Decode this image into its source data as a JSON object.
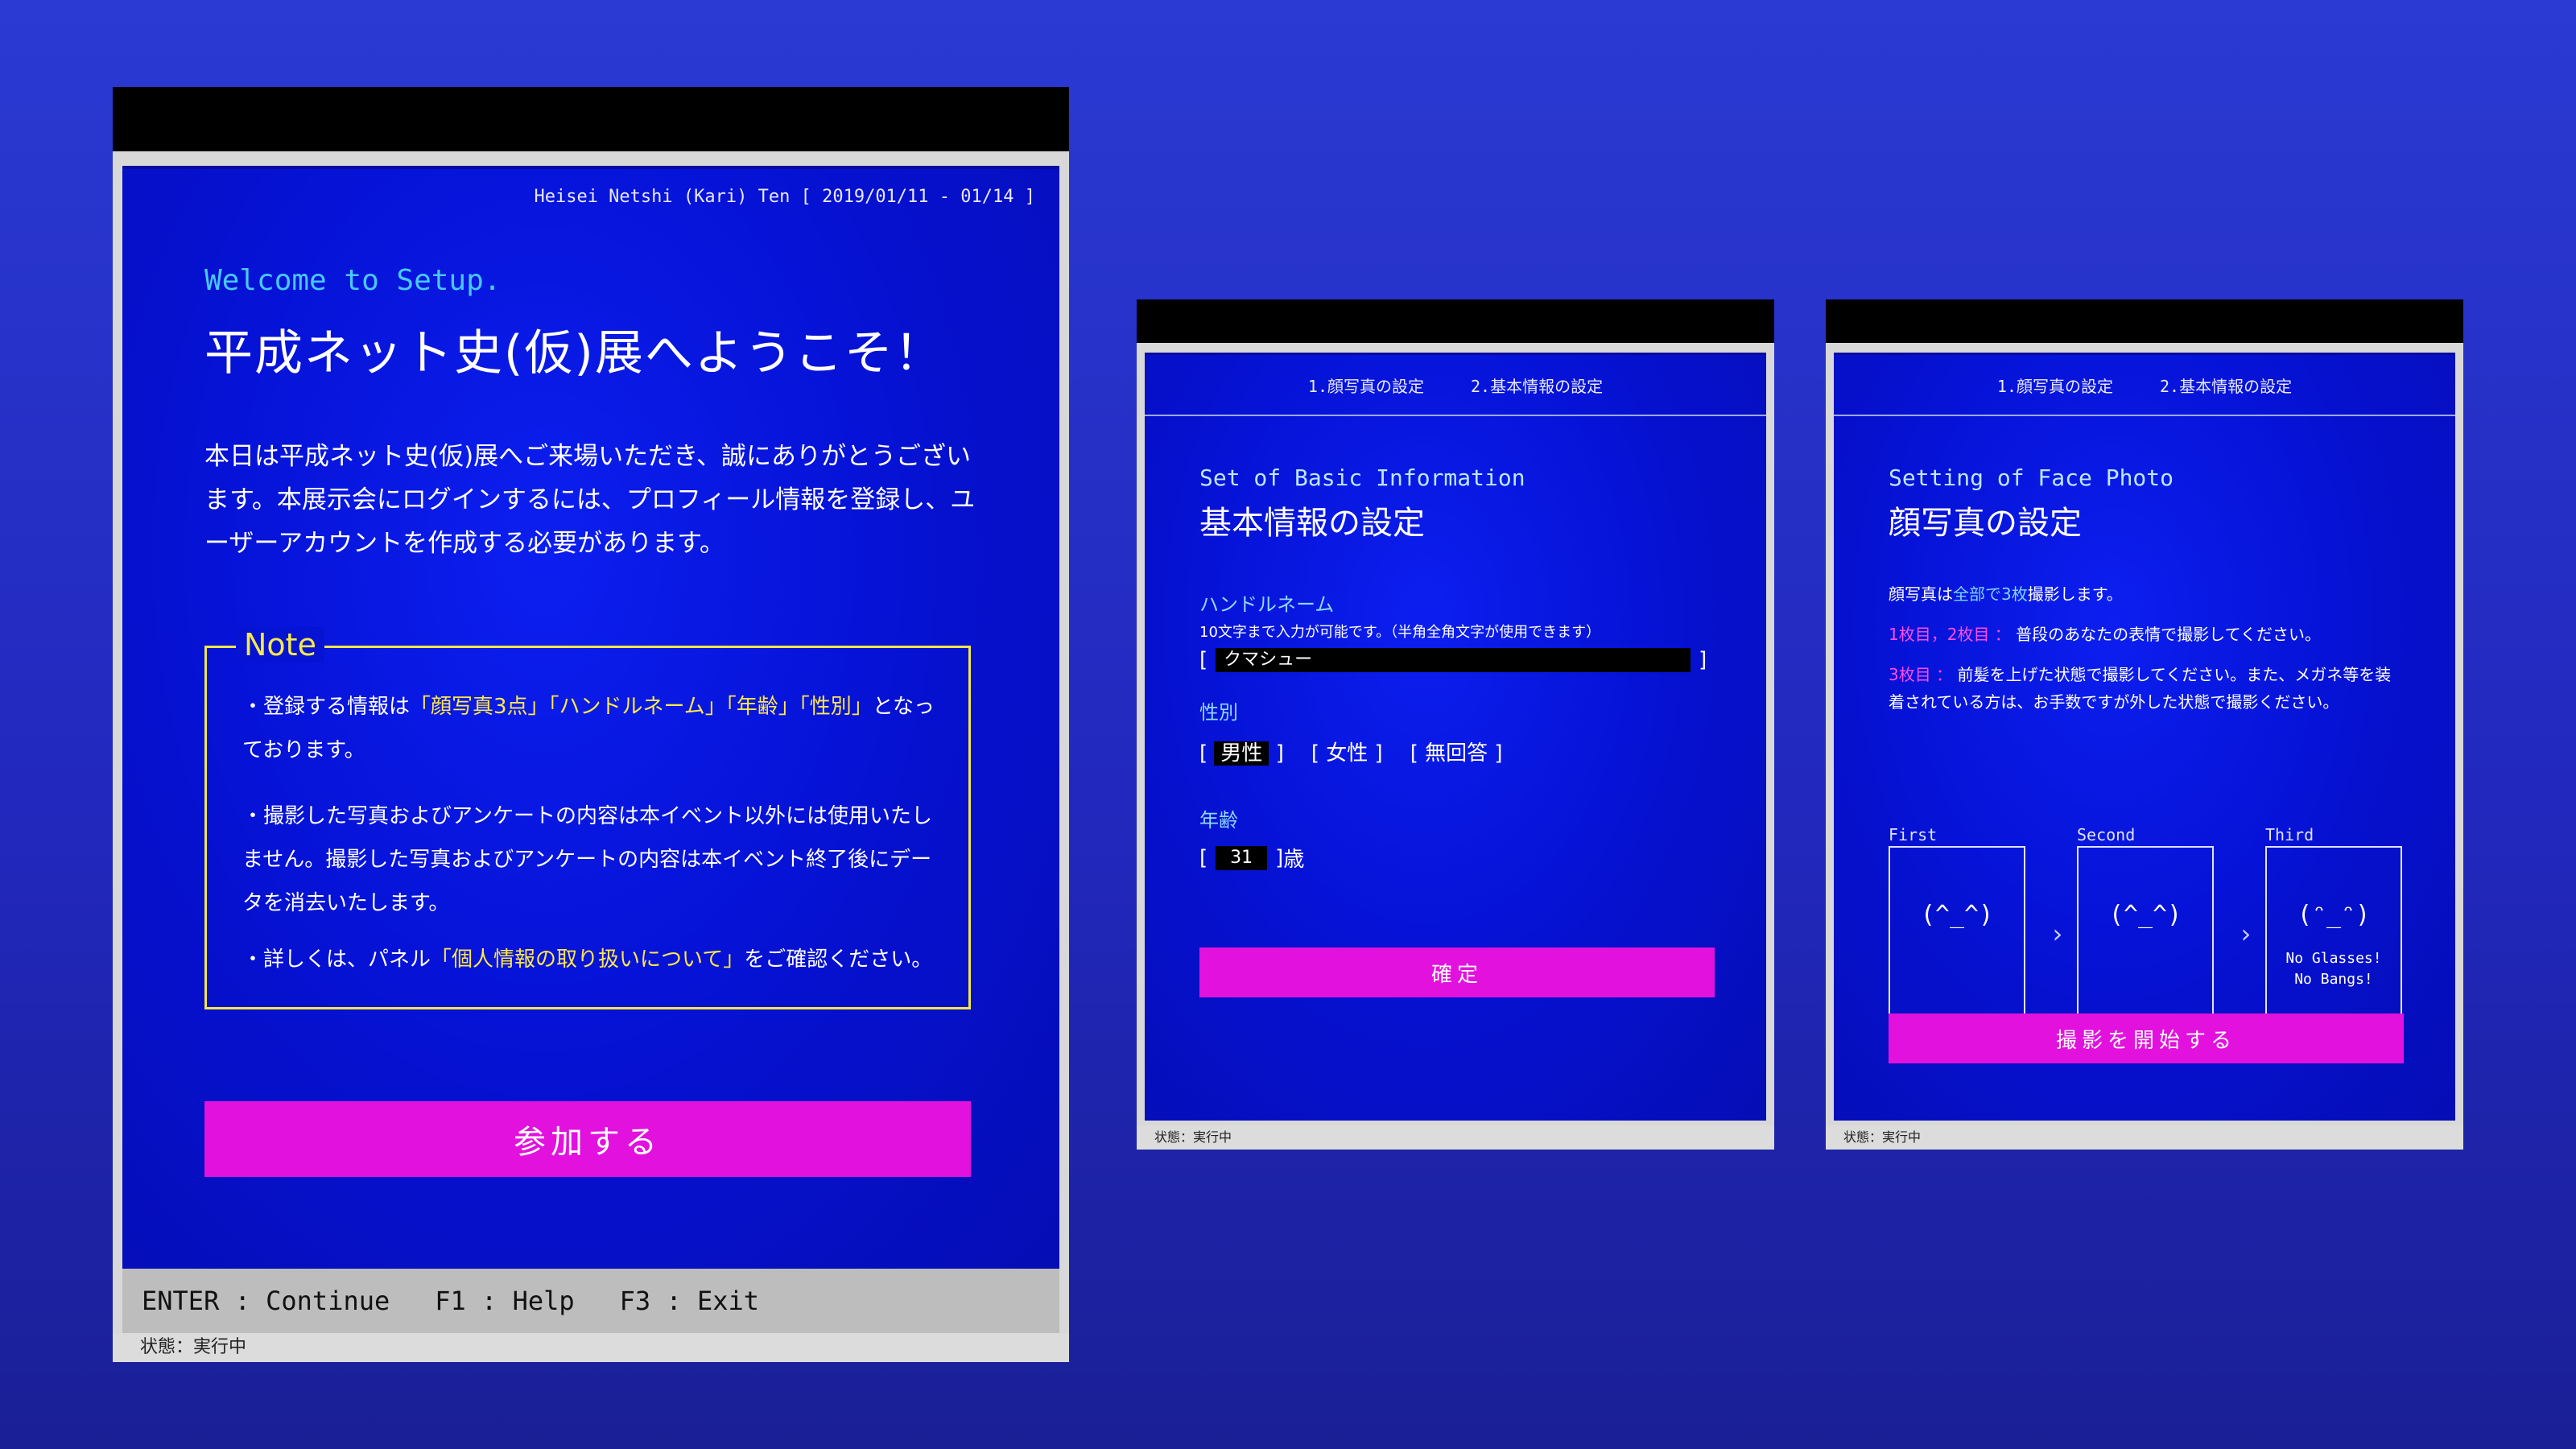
{
  "main": {
    "header_info": "Heisei Netshi (Kari) Ten [ 2019/01/11 - 01/14 ]",
    "welcome": "Welcome to Setup.",
    "title": "平成ネット史(仮)展へようこそ！",
    "intro": "本日は平成ネット史(仮)展へご来場いただき、誠にありがとうございます。本展示会にログインするには、プロフィール情報を登録し、ユーザーアカウントを作成する必要があります。",
    "note_label": "Note",
    "note1_a": "・登録する情報は",
    "note1_hl": "「顔写真3点」「ハンドルネーム」「年齢」「性別」",
    "note1_b": "となっております。",
    "note2": "・撮影した写真およびアンケートの内容は本イベント以外には使用いたしません。撮影した写真およびアンケートの内容は本イベント終了後にデータを消去いたします。",
    "note3_a": "・詳しくは、パネル",
    "note3_hl": "「個人情報の取り扱いについて」",
    "note3_b": "をご確認ください。",
    "join_button": "参加する",
    "keys": [
      "ENTER : Continue",
      "F1 : Help",
      "F3 : Exit"
    ],
    "status": "状態：実行中"
  },
  "basic": {
    "tabs": [
      "1.顔写真の設定",
      "2.基本情報の設定"
    ],
    "section_en": "Set of Basic Information",
    "section_ja": "基本情報の設定",
    "handle_label": "ハンドルネーム",
    "handle_hint": "10文字まで入力が可能です。（半角全角文字が使用できます）",
    "handle_value": "クマシュー",
    "gender_label": "性別",
    "gender_options": [
      "男性",
      "女性",
      "無回答"
    ],
    "age_label": "年齢",
    "age_value": "31",
    "age_unit": "歳",
    "confirm_button": "確定",
    "status": "状態：実行中"
  },
  "photo": {
    "tabs": [
      "1.顔写真の設定",
      "2.基本情報の設定"
    ],
    "section_en": "Setting of Face Photo",
    "section_ja": "顔写真の設定",
    "line1_a": "顔写真は",
    "line1_hl": "全部で3枚",
    "line1_b": "撮影します。",
    "line2_hl": "1枚目，2枚目 ：",
    "line2_b": " 普段のあなたの表情で撮影してください。",
    "line3_hl": "3枚目 ：",
    "line3_b": " 前髪を上げた状態で撮影してください。また、メガネ等を装着されている方は、お手数ですが外した状態で撮影ください。",
    "shots": [
      {
        "label": "First",
        "face": "(^_^)",
        "note1": "",
        "note2": ""
      },
      {
        "label": "Second",
        "face": "(^_^)",
        "note1": "",
        "note2": ""
      },
      {
        "label": "Third",
        "face": "(ᵔ_ᵔ)",
        "note1": "No Glasses!",
        "note2": "No Bangs!"
      }
    ],
    "start_button": "撮影を開始する",
    "status": "状態：実行中"
  }
}
